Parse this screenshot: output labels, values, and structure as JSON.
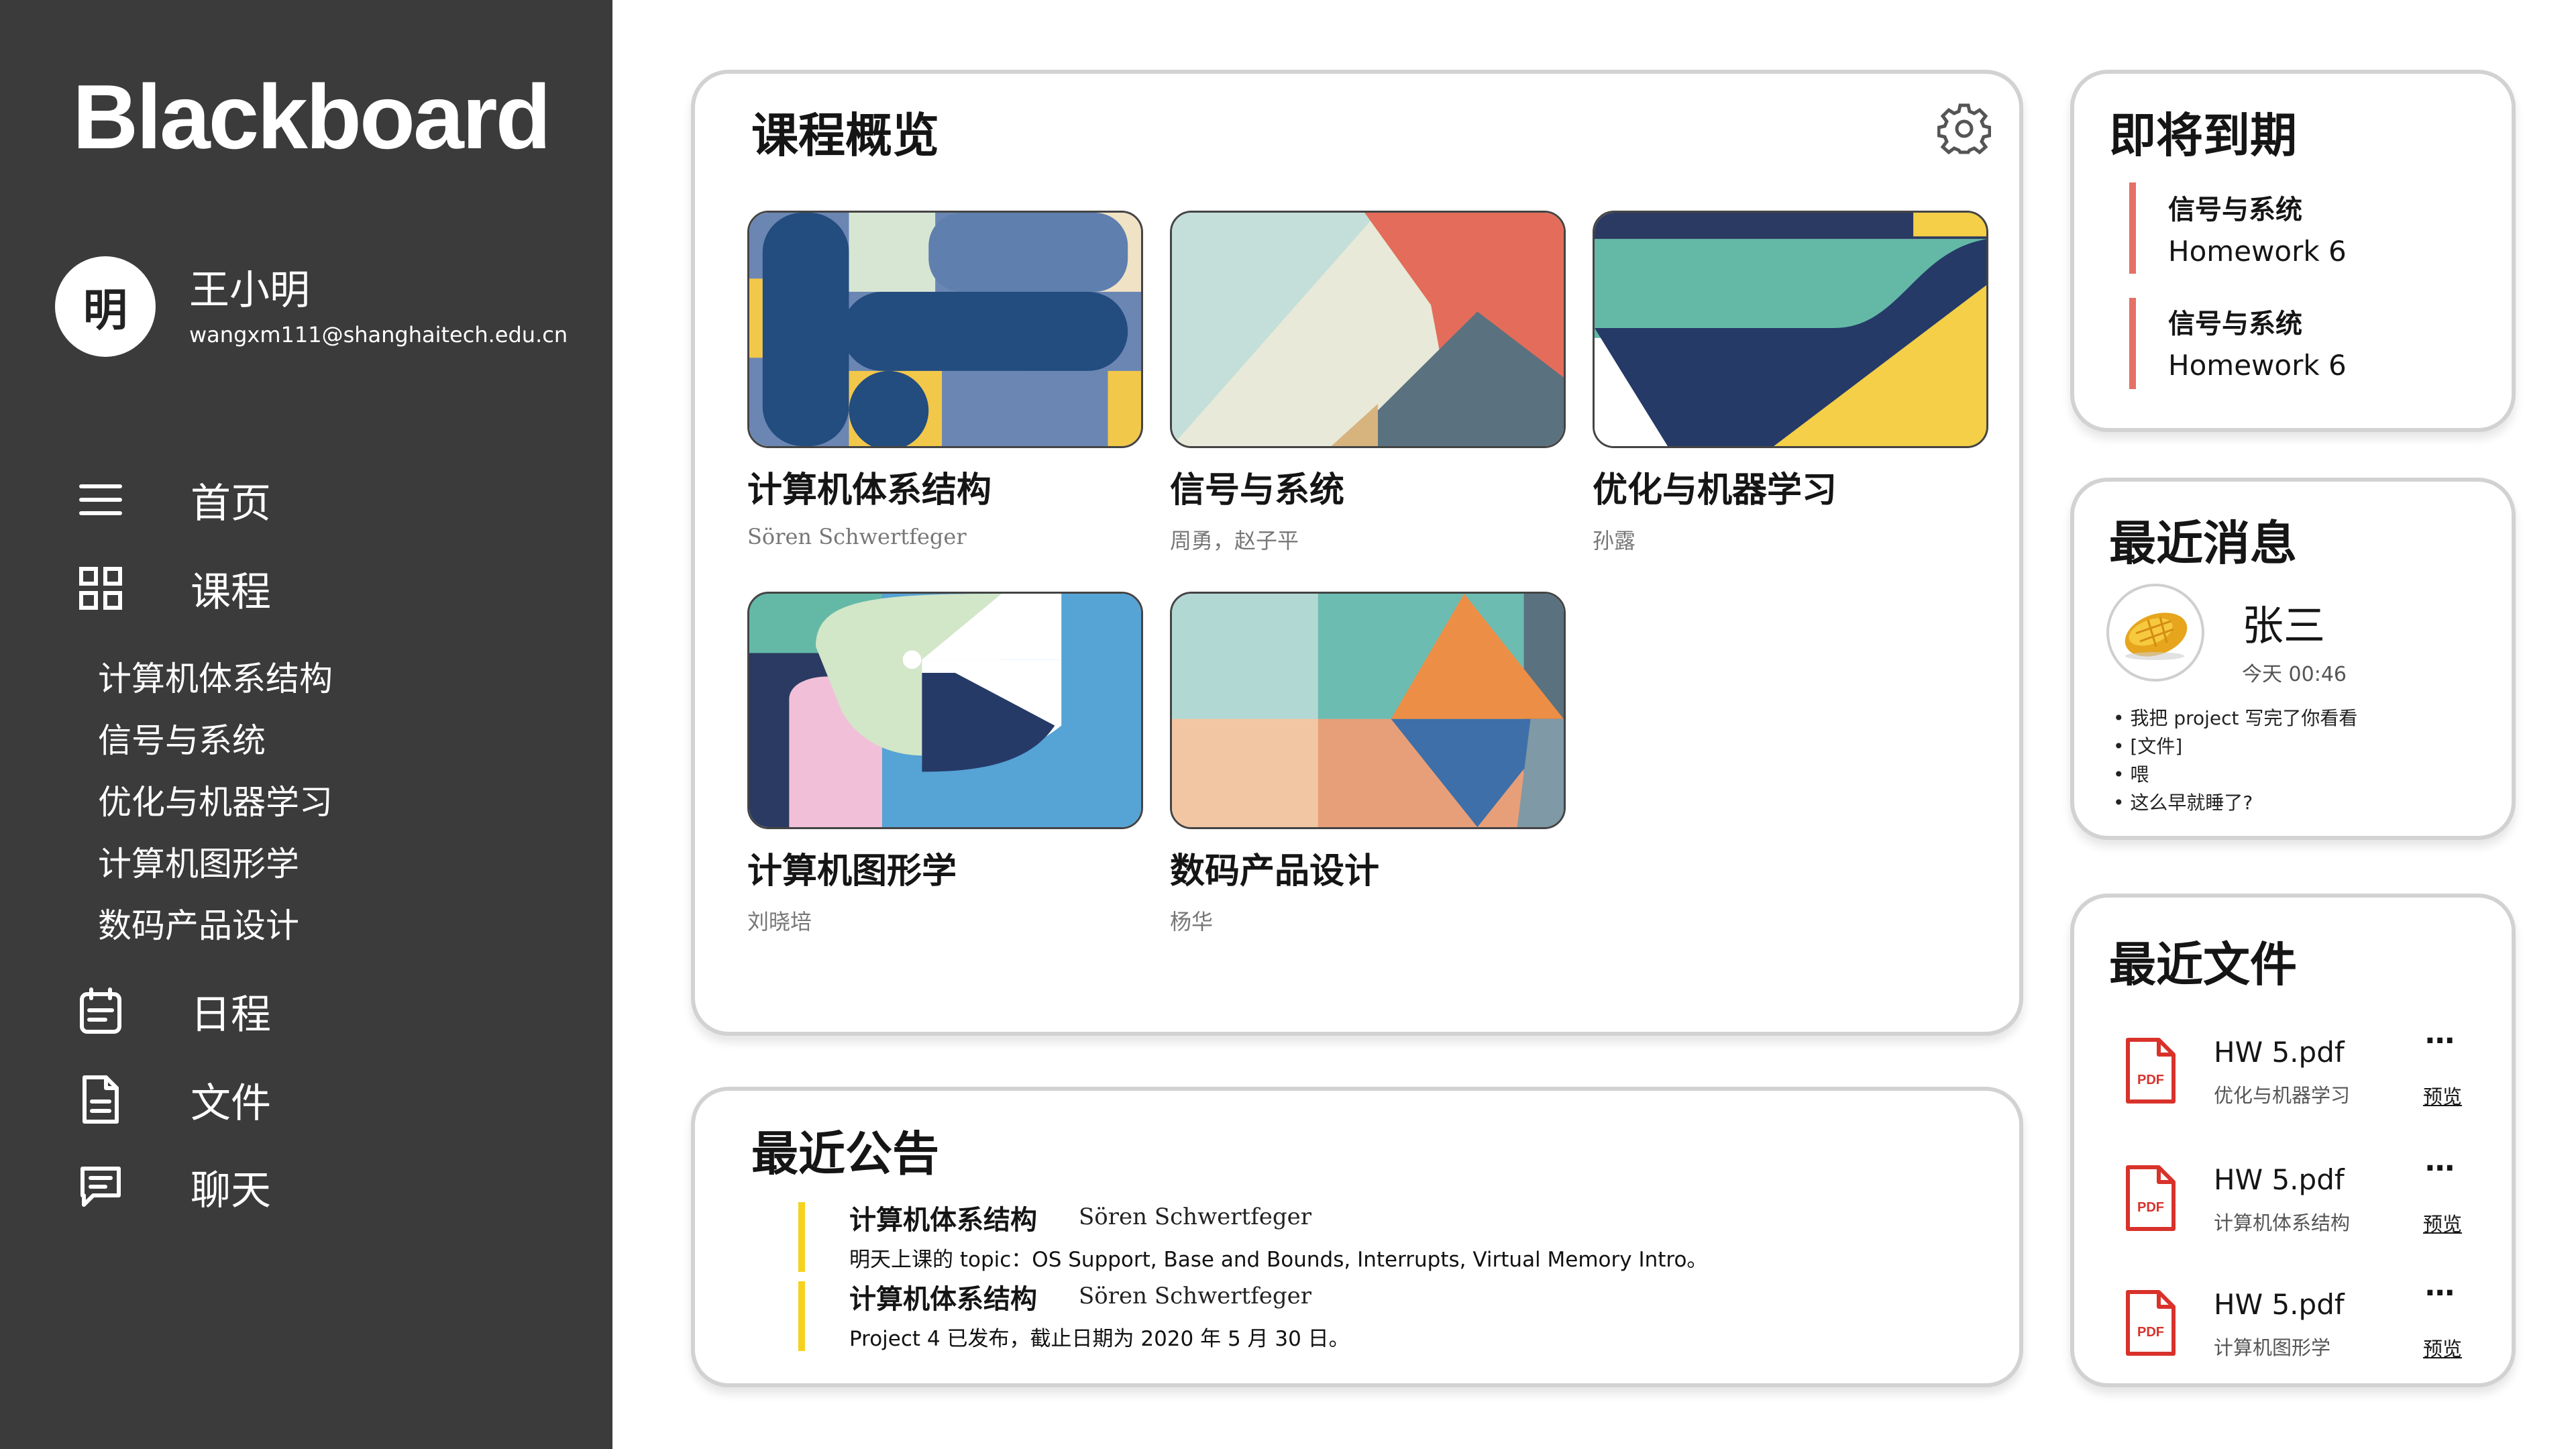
{
  "app": {
    "logo": "Blackboard"
  },
  "user": {
    "avatar_char": "明",
    "name": "王小明",
    "email": "wangxm111@shanghaitech.edu.cn"
  },
  "nav": {
    "home": "首页",
    "courses": "课程",
    "course_items": [
      "计算机体系结构",
      "信号与系统",
      "优化与机器学习",
      "计算机图形学",
      "数码产品设计"
    ],
    "schedule": "日程",
    "files": "文件",
    "chat": "聊天"
  },
  "overview": {
    "title": "课程概览",
    "courses": [
      {
        "name": "计算机体系结构",
        "teacher": "Sören Schwertfeger"
      },
      {
        "name": "信号与系统",
        "teacher": "周勇，赵子平"
      },
      {
        "name": "优化与机器学习",
        "teacher": "孙露"
      },
      {
        "name": "计算机图形学",
        "teacher": "刘晓培"
      },
      {
        "name": "数码产品设计",
        "teacher": "杨华"
      }
    ]
  },
  "announcements": {
    "title": "最近公告",
    "items": [
      {
        "course": "计算机体系结构",
        "author": "Sören Schwertfeger",
        "text": "明天上课的 topic：OS Support, Base and Bounds, Interrupts, Virtual Memory Intro。"
      },
      {
        "course": "计算机体系结构",
        "author": "Sören Schwertfeger",
        "text": "Project 4 已发布，截止日期为 2020 年 5 月 30 日。"
      }
    ]
  },
  "due": {
    "title": "即将到期",
    "items": [
      {
        "course": "信号与系统",
        "hw": "Homework 6"
      },
      {
        "course": "信号与系统",
        "hw": "Homework 6"
      }
    ]
  },
  "messages": {
    "title": "最近消息",
    "sender": "张三",
    "time": "今天 00:46",
    "lines": [
      "我把 project 写完了你看看",
      "[文件]",
      "喂",
      "这么早就睡了?"
    ]
  },
  "files": {
    "title": "最近文件",
    "more_label": "···",
    "preview_label": "预览",
    "icon_label": "PDF",
    "items": [
      {
        "name": "HW 5.pdf",
        "course": "优化与机器学习"
      },
      {
        "name": "HW 5.pdf",
        "course": "计算机体系结构"
      },
      {
        "name": "HW 5.pdf",
        "course": "计算机图形学"
      }
    ]
  },
  "colors": {
    "sidebar": "#3b3b3b",
    "announcement_bar": "#f6d21f",
    "due_bar": "#e57065",
    "pdf_red": "#d8322b"
  },
  "icons": {
    "home": "hamburger-icon",
    "courses": "grid-icon",
    "schedule": "calendar-icon",
    "files": "document-icon",
    "chat": "chat-icon",
    "settings": "gear-icon",
    "file": "pdf-file-icon"
  }
}
